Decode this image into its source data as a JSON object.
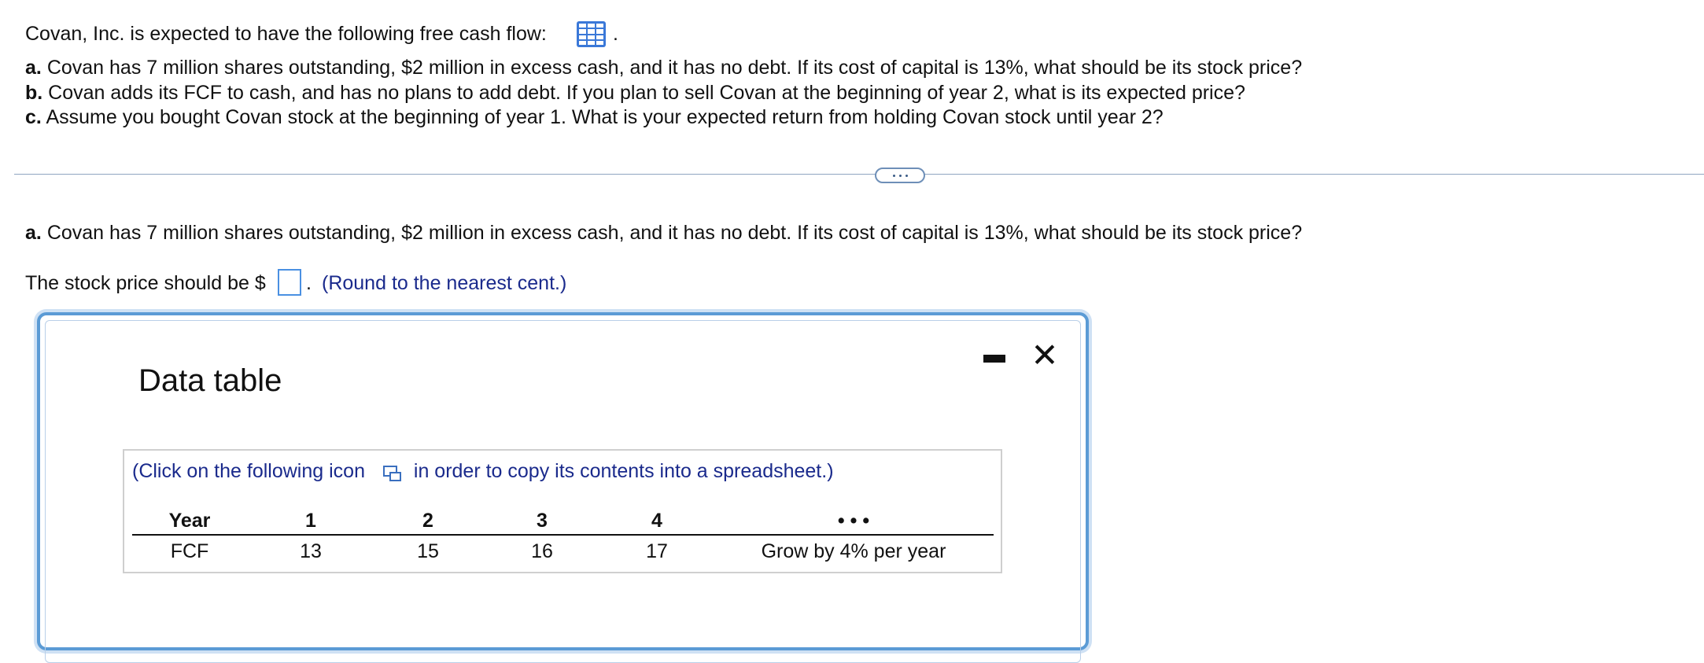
{
  "problem": {
    "intro": "Covan, Inc. is expected to have the following free cash flow:",
    "intro_period": ".",
    "data_icon": "table-grid-icon",
    "parts": [
      {
        "label": "a.",
        "text": "Covan has 7 million shares outstanding, $2 million in excess cash, and it has no debt. If its cost of capital is 13%, what should be its stock price?"
      },
      {
        "label": "b.",
        "text": "Covan adds its FCF to cash, and has no plans to add debt. If you plan to sell Covan at the beginning of year 2, what is its expected price?"
      },
      {
        "label": "c.",
        "text": "Assume you bought Covan stock at the beginning of year 1. What is your expected return from holding Covan stock until year 2?"
      }
    ]
  },
  "current_question": {
    "label": "a.",
    "text": "Covan has 7 million shares outstanding, $2 million in excess cash, and it has no debt. If its cost of capital is 13%, what should be its stock price?",
    "answer_prefix": "The stock price should be $",
    "answer_value": "",
    "answer_suffix": ".",
    "hint": "(Round to the nearest cent.)"
  },
  "modal": {
    "title": "Data table",
    "copy_before": "(Click on the following icon",
    "copy_after": "in order to copy its contents into a spreadsheet.)",
    "table": {
      "headers": [
        "Year",
        "1",
        "2",
        "3",
        "4",
        "• • •"
      ],
      "row_label": "FCF",
      "values": [
        "13",
        "15",
        "16",
        "17",
        "Grow by 4% per year"
      ]
    }
  },
  "colors": {
    "accent_blue": "#3a78d8",
    "hint_text": "#1a2a8c",
    "modal_border": "#5b9bd5"
  }
}
